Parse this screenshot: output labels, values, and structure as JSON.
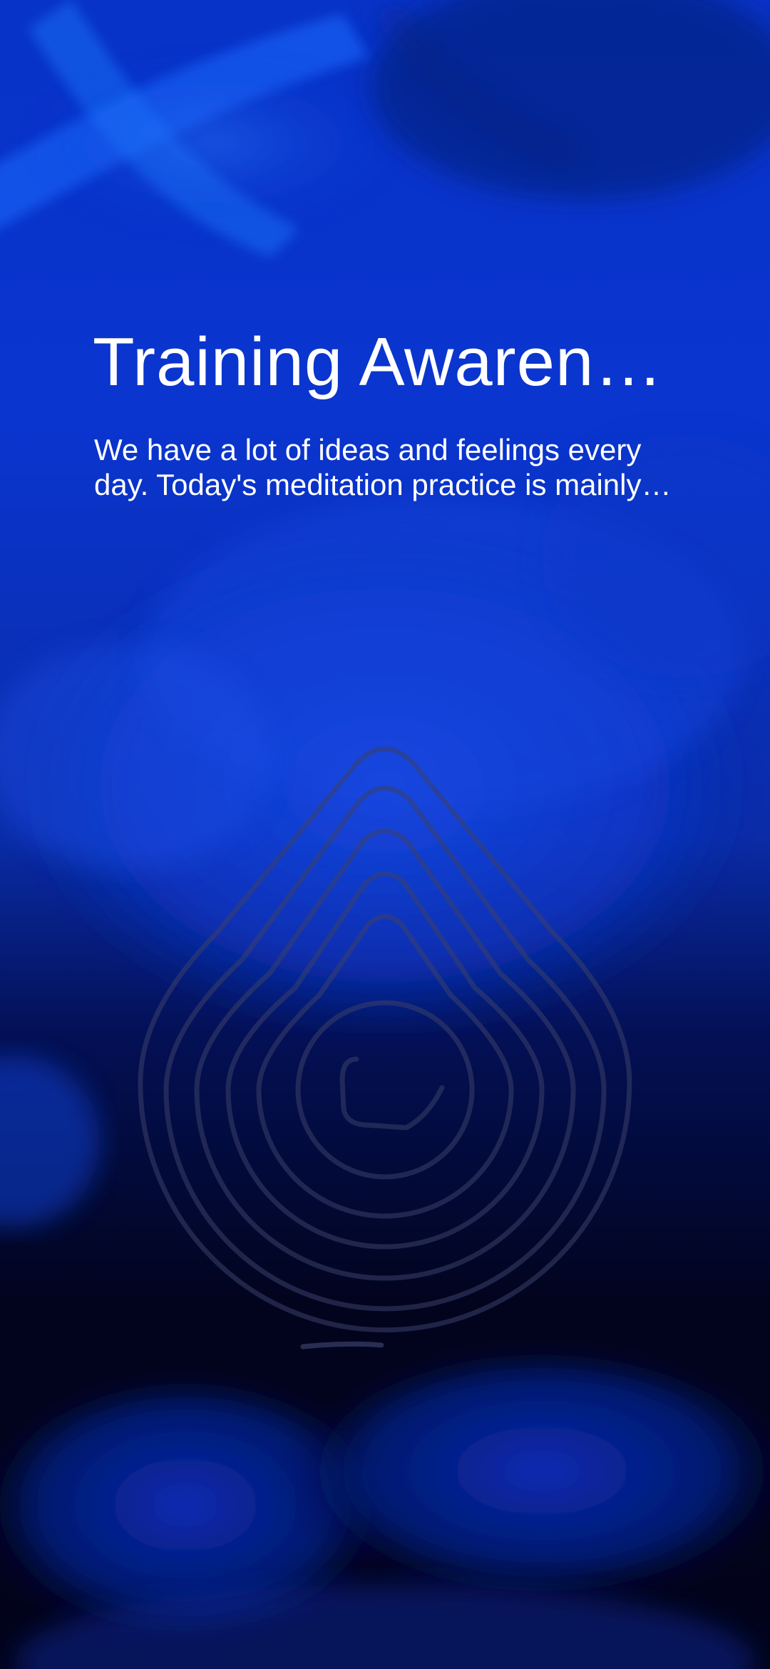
{
  "session": {
    "title": "Training Awareness",
    "description": "We have a lot of ideas and feelings every day. Today's meditation practice is mainly about training awareness."
  },
  "background": {
    "subject": "jellyfish",
    "colors": {
      "top": "#0a2fd6",
      "middle": "#0a36c9",
      "bottom": "#02031a"
    }
  },
  "breathing_visual": {
    "icon": "water-drop-rings-icon",
    "ring_count": 6,
    "stroke_color": "#3a3f6a"
  }
}
